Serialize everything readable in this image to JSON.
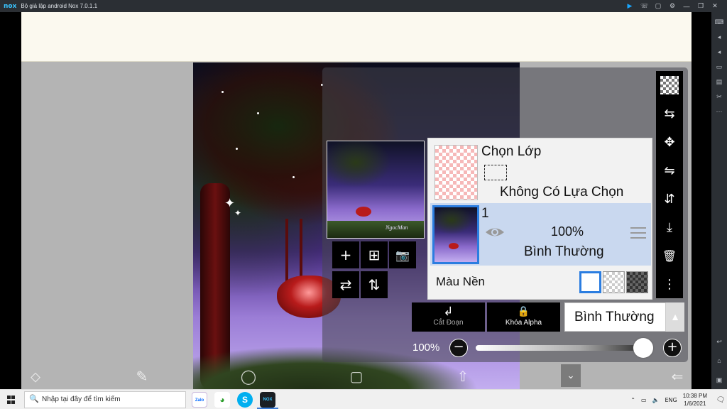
{
  "emulator": {
    "logo": "nox",
    "title": "Bộ giả lập android Nox 7.0.1.1",
    "toolbar_icons": [
      "play-icon",
      "phone-icon",
      "skin-icon",
      "settings-icon",
      "minimize-icon",
      "maximize-icon",
      "close-icon"
    ],
    "toolbar_glyphs": {
      "play": "▶",
      "phone": "☏",
      "skin": "▢",
      "settings": "⚙",
      "minimize": "—",
      "maximize": "❐",
      "close": "✕"
    },
    "sidebar_glyphs": {
      "keyboard": "⌨",
      "vol_up": "◂",
      "vol_down": "◂",
      "screen": "▭",
      "apk": "▤",
      "scissors": "✂",
      "more": "⋯",
      "back": "↩",
      "home": "⌂",
      "recent": "▣"
    }
  },
  "app": {
    "thumbnail_signature": "NgocMan",
    "tool_buttons": {
      "add": "+",
      "add_layer": "⊞",
      "camera": "📷",
      "flip": "⇄",
      "flip_vertical": "⇅"
    },
    "vertical_toolbar": {
      "transform": "⇆",
      "move": "✥",
      "flip_h": "⇋",
      "flip_v": "⇵",
      "merge_down": "⤓",
      "delete": "🗑",
      "more": "⋮"
    },
    "layers": {
      "selection_layer": {
        "title": "Chọn Lớp",
        "status": "Không Có Lựa Chọn"
      },
      "layer_1": {
        "name": "1",
        "opacity": "100%",
        "blend_mode": "Bình Thường"
      },
      "background_label": "Màu Nền"
    },
    "actions": {
      "cut": {
        "icon": "↲",
        "label": "Cắt Đoạn"
      },
      "alpha": {
        "icon": "🔒",
        "label": "Khóa Alpha"
      },
      "blend_mode": "Bình Thường",
      "blend_arrow": "▲"
    },
    "opacity": {
      "label": "100%",
      "value": 1.0,
      "minus": "−",
      "plus": "+"
    },
    "bottom_bar": {
      "rotate": "⬦",
      "brush": "✎",
      "circle": "◯",
      "square": "▢",
      "arrow_up": "⇧",
      "chevron": "⌄",
      "back": "⇐"
    }
  },
  "taskbar": {
    "search_icon": "🔍",
    "search_placeholder": "Nhập tại đây để tìm kiếm",
    "apps": {
      "zalo": "Zalo",
      "chrome": "◕",
      "skype": "S",
      "nox": "NOX"
    },
    "tray": {
      "chevron": "⌃",
      "network": "▭",
      "volume": "🔈",
      "language": "ENG"
    },
    "time": "10:38 PM",
    "date": "1/6/2021",
    "notification": "🗨"
  }
}
